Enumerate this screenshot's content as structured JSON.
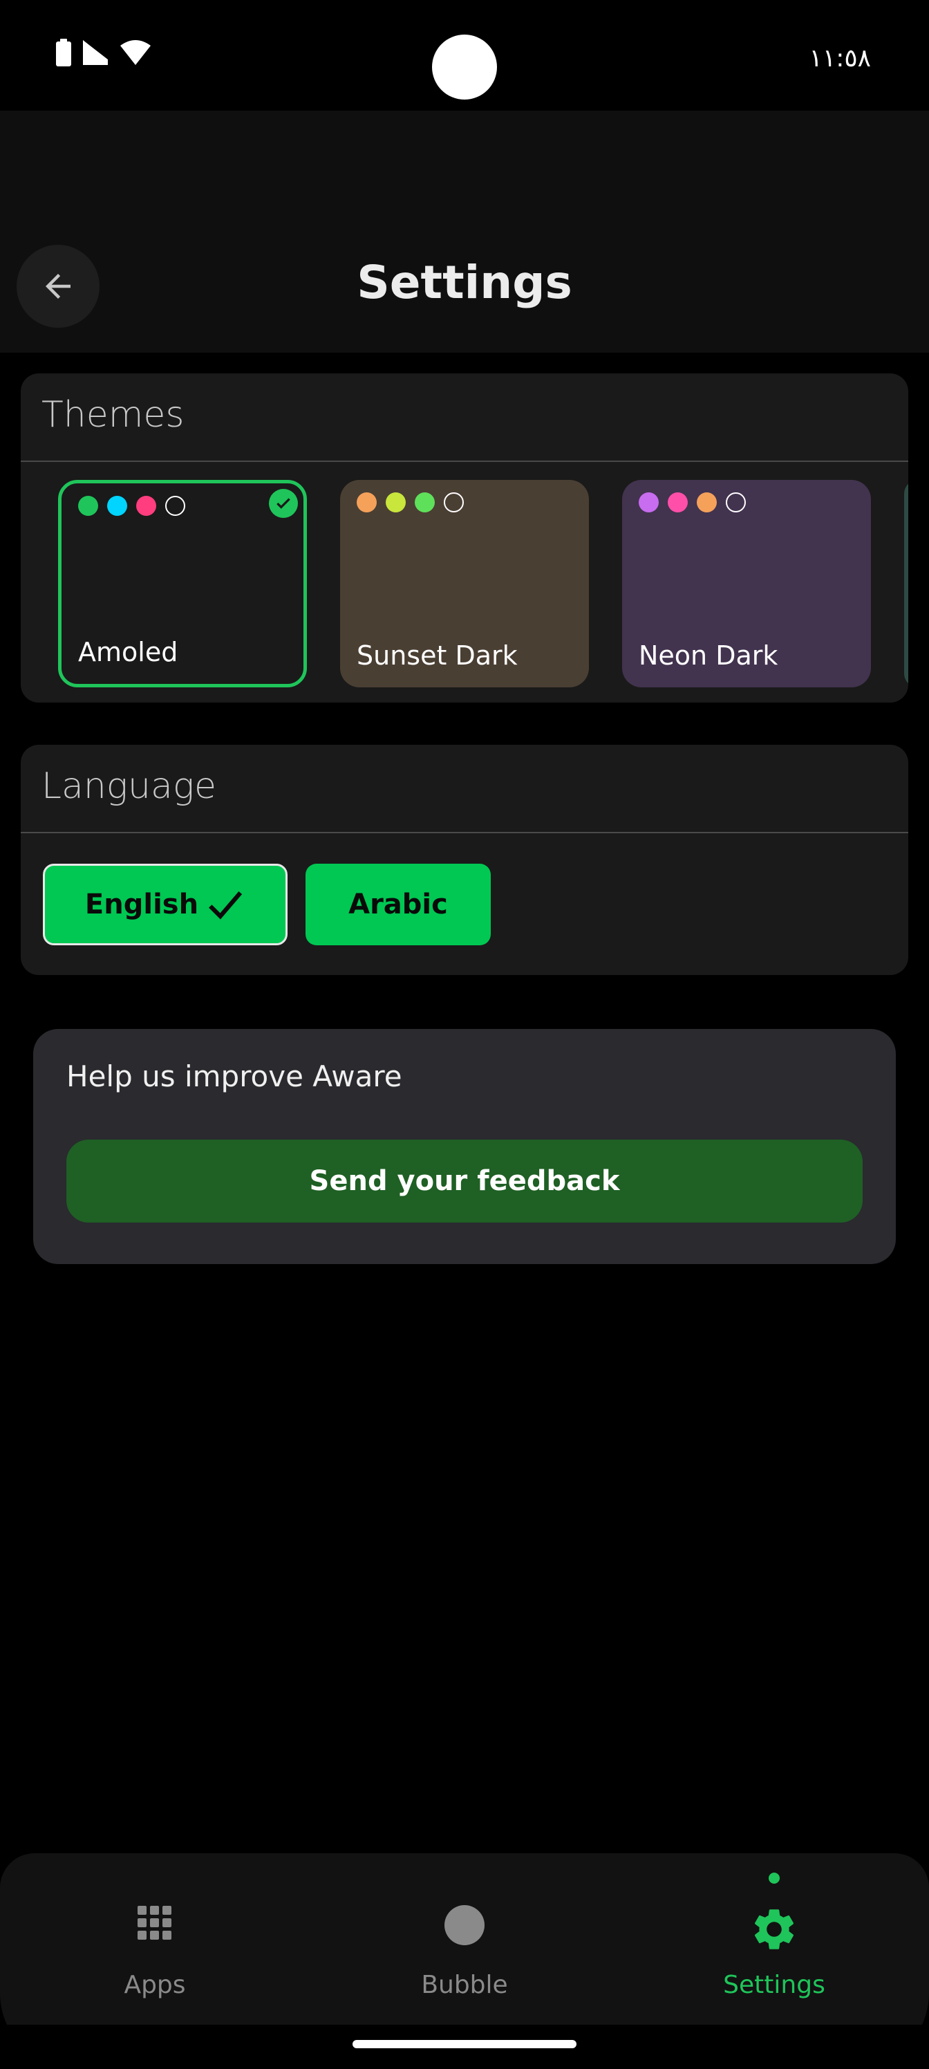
{
  "status_bar": {
    "time": "١١:٥٨"
  },
  "header": {
    "title": "Settings"
  },
  "themes": {
    "title": "Themes",
    "items": [
      {
        "label": "Amoled",
        "selected": true,
        "bg": "#1a1a1a",
        "dots": [
          "#1fc55a",
          "#00d4ff",
          "#ff3d7f",
          "#1a1a1a"
        ]
      },
      {
        "label": "Sunset Dark",
        "selected": false,
        "bg": "#4a3f33",
        "dots": [
          "#f5a15a",
          "#c8e63c",
          "#5fe05a",
          "#4a3f33"
        ]
      },
      {
        "label": "Neon Dark",
        "selected": false,
        "bg": "#42334f",
        "dots": [
          "#c86cf0",
          "#ff4fa8",
          "#f5a15a",
          "#42334f"
        ]
      }
    ]
  },
  "language": {
    "title": "Language",
    "options": [
      {
        "label": "English",
        "selected": true
      },
      {
        "label": "Arabic",
        "selected": false
      }
    ]
  },
  "feedback": {
    "text": "Help us improve Aware",
    "button_label": "Send your feedback"
  },
  "bottom_nav": {
    "items": [
      {
        "label": "Apps",
        "icon": "grid-icon",
        "active": false
      },
      {
        "label": "Bubble",
        "icon": "bubble-icon",
        "active": false
      },
      {
        "label": "Settings",
        "icon": "gear-icon",
        "active": true
      }
    ]
  },
  "colors": {
    "accent": "#1fc55a",
    "feedback_button": "#1f6024",
    "language_button": "#00c853"
  }
}
